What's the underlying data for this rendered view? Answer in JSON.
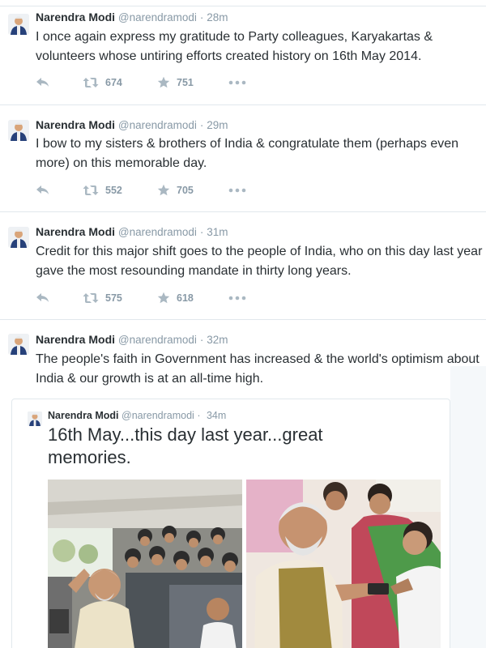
{
  "tweets": [
    {
      "name": "Narendra Modi",
      "handle": "@narendramodi",
      "separator": "·",
      "time": "28m",
      "lines": [
        "I once again express my gratitude to Party colleagues, Karyakartas &",
        "volunteers whose untiring efforts created history on 16th May 2014."
      ],
      "retweets": "674",
      "favorites": "751"
    },
    {
      "name": "Narendra Modi",
      "handle": "@narendramodi",
      "separator": "·",
      "time": "29m",
      "lines": [
        "I bow to my sisters & brothers of India & congratulate them (perhaps even",
        "more) on this memorable day."
      ],
      "retweets": "552",
      "favorites": "705"
    },
    {
      "name": "Narendra Modi",
      "handle": "@narendramodi",
      "separator": "·",
      "time": "31m",
      "lines": [
        "Credit for this major shift goes to the people of India, who on this day last year",
        "gave the most resounding mandate in thirty long years."
      ],
      "retweets": "575",
      "favorites": "618"
    },
    {
      "name": "Narendra Modi",
      "handle": "@narendramodi",
      "separator": "·",
      "time": "32m",
      "lines": [
        "The people's faith in Government has increased & the world's optimism about",
        "India & our growth is at an all-time high."
      ]
    }
  ],
  "quoted": {
    "name": "Narendra Modi",
    "handle": "@narendramodi",
    "separator": "·",
    "time": "34m",
    "lines": [
      "16th May...this day last year...great",
      "memories."
    ]
  },
  "icons": {
    "reply": "reply-icon",
    "retweet": "retweet-icon",
    "favorite": "star-icon",
    "more": "more-dots-icon"
  },
  "colors": {
    "text": "#292f33",
    "muted": "#8899a6",
    "icon": "#aab8c2",
    "border": "#e1e8ed"
  }
}
